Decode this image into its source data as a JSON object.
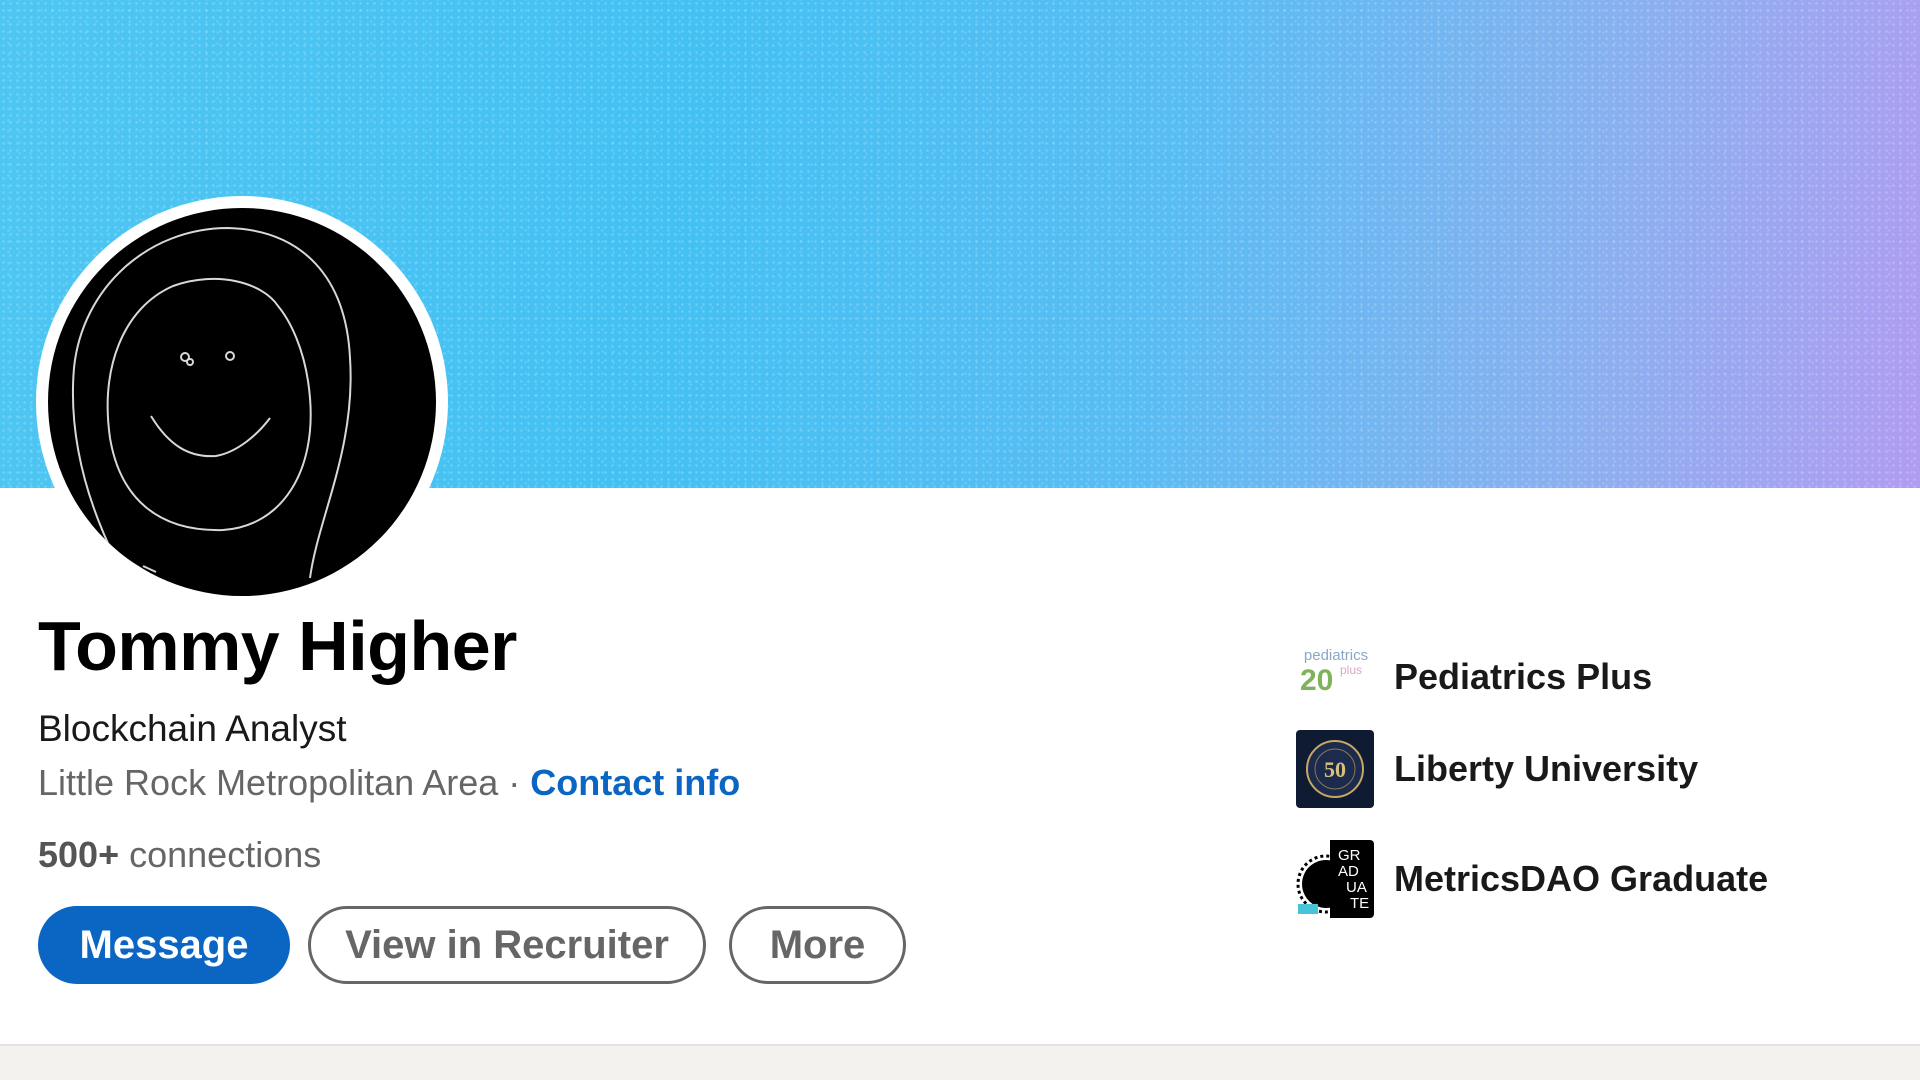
{
  "profile": {
    "name": "Tommy Higher",
    "headline": "Blockchain Analyst",
    "location": "Little Rock Metropolitan Area",
    "separator": "·",
    "contact_info": "Contact info",
    "connections_count": "500+",
    "connections_label": "connections"
  },
  "actions": {
    "message": "Message",
    "view_in_recruiter": "View in Recruiter",
    "more": "More"
  },
  "organizations": [
    {
      "label": "Pediatrics Plus",
      "icon": "pediatrics-plus-logo"
    },
    {
      "label": "Liberty University",
      "icon": "liberty-university-seal"
    },
    {
      "label": "MetricsDAO Graduate",
      "icon": "metricsdao-graduate-badge"
    }
  ],
  "logos": {
    "pediatrics_small": "pediatrics",
    "pediatrics_number": "20",
    "pediatrics_plus": "plus",
    "liberty_number": "50",
    "metrics_lines": [
      "GR",
      "AD",
      "UA",
      "TE"
    ]
  },
  "colors": {
    "accent": "#0a66c2",
    "banner_start": "#4fc6f2",
    "banner_end": "#b19cf2",
    "text_muted": "#666666"
  }
}
